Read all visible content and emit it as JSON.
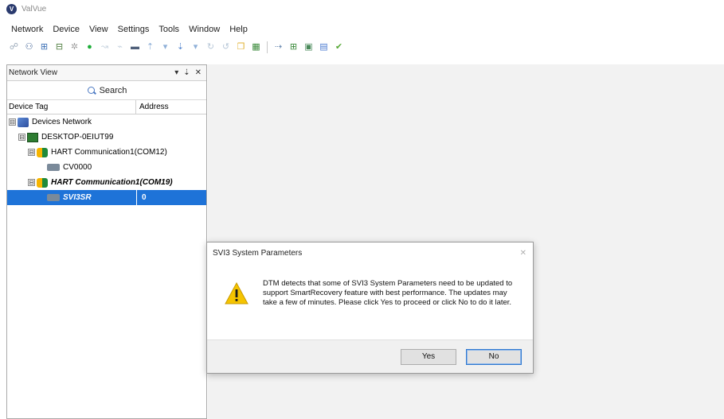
{
  "app": {
    "title": "ValVue",
    "icon": "valve-logo-icon",
    "accent": "#1e73d8"
  },
  "menu": [
    "Network",
    "Device",
    "View",
    "Settings",
    "Tools",
    "Window",
    "Help"
  ],
  "panel": {
    "title": "Network View",
    "controls": [
      "▾",
      "⇣",
      "✕"
    ],
    "search_label": "Search",
    "columns": {
      "tag": "Device Tag",
      "address": "Address"
    },
    "tree": [
      {
        "label": "Devices Network",
        "icon": "network-icon",
        "expander": "⊟",
        "address": ""
      },
      {
        "label": "DESKTOP-0EIUT99",
        "icon": "computer-icon",
        "expander": "⊟",
        "address": ""
      },
      {
        "label": "HART Communication1(COM12)",
        "icon": "hart-modem-icon",
        "expander": "⊟",
        "address": ""
      },
      {
        "label": "CV0000",
        "icon": "device-icon",
        "expander": "",
        "address": ""
      },
      {
        "label": "HART Communication1(COM19)",
        "icon": "hart-modem-icon",
        "expander": "⊟",
        "address": ""
      },
      {
        "label": "SVI3SR",
        "icon": "device-icon",
        "expander": "",
        "address": "0"
      }
    ]
  },
  "dialog": {
    "title": "SVI3 System Parameters",
    "close": "✕",
    "message": "DTM detects that some of SVI3 System Parameters need to be updated to support SmartRecovery feature with best performance.  The updates may take a few of minutes.  Please click Yes to proceed or click No to do it later.",
    "yes_label": "Yes",
    "no_label": "No",
    "warn_color": "#f5c400"
  }
}
